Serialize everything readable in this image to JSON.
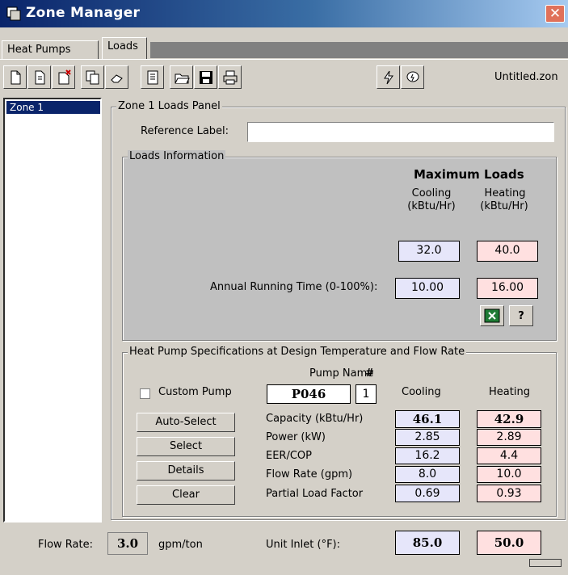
{
  "window": {
    "title": "Zone Manager",
    "close_label": "✕"
  },
  "tabs": [
    {
      "label": "Heat Pumps"
    },
    {
      "label": "Loads"
    }
  ],
  "toolbar": {
    "filename": "Untitled.zon"
  },
  "zones": [
    {
      "label": "Zone 1"
    }
  ],
  "panel": {
    "title": "Zone 1 Loads Panel",
    "reference_label": "Reference Label:",
    "reference_value": ""
  },
  "loads": {
    "title": "Loads Information",
    "max_loads_heading": "Maximum Loads",
    "cooling_header": "Cooling",
    "heating_header": "Heating",
    "unit": "(kBtu/Hr)",
    "cooling_value": "32.0",
    "heating_value": "40.0",
    "running_time_label": "Annual Running Time (0-100%):",
    "cooling_running_time": "10.00",
    "heating_running_time": "16.00",
    "help_label": "?"
  },
  "spec": {
    "title": "Heat Pump Specifications at Design Temperature and Flow Rate",
    "custom_pump_label": "Custom Pump",
    "pump_name_header": "Pump Name",
    "pump_num_header": "#",
    "pump_name": "P046",
    "pump_num": "1",
    "cooling_header": "Cooling",
    "heating_header": "Heating",
    "buttons": [
      "Auto-Select",
      "Select",
      "Details",
      "Clear"
    ],
    "rows": [
      {
        "label": "Capacity (kBtu/Hr)",
        "cooling": "46.1",
        "heating": "42.9"
      },
      {
        "label": "Power (kW)",
        "cooling": "2.85",
        "heating": "2.89"
      },
      {
        "label": "EER/COP",
        "cooling": "16.2",
        "heating": "4.4"
      },
      {
        "label": "Flow Rate (gpm)",
        "cooling": "8.0",
        "heating": "10.0"
      },
      {
        "label": "Partial Load Factor",
        "cooling": "0.69",
        "heating": "0.93"
      }
    ]
  },
  "footer": {
    "flow_rate_label": "Flow Rate:",
    "flow_rate_value": "3.0",
    "flow_rate_unit": "gpm/ton",
    "inlet_label": "Unit Inlet (°F):",
    "inlet_cooling": "85.0",
    "inlet_heating": "50.0"
  },
  "colors": {
    "cooling_bg": "#e6e6fa",
    "heating_bg": "#ffe0e0",
    "title_bar": "#0a246a",
    "close_button": "#e0715a"
  }
}
